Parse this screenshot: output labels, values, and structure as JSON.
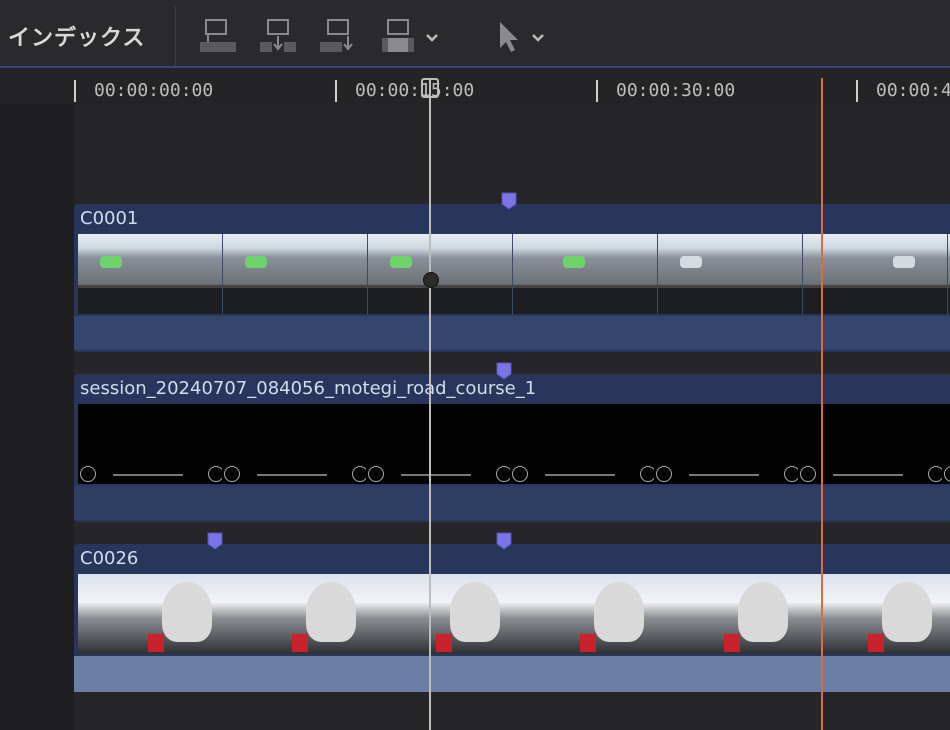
{
  "toolbar": {
    "index_label": "インデックス",
    "buttons": [
      {
        "icon": "connect-clip-icon"
      },
      {
        "icon": "insert-clip-icon"
      },
      {
        "icon": "append-clip-icon"
      },
      {
        "icon": "overwrite-clip-icon"
      },
      {
        "icon": "select-tool-icon"
      }
    ]
  },
  "ruler": {
    "timecodes": [
      "00:00:00:00",
      "00:00:15:00",
      "00:00:30:00",
      "00:00:4"
    ]
  },
  "clips": [
    {
      "name": "C0001"
    },
    {
      "name": "session_20240707_084056_motegi_road_course_1"
    },
    {
      "name": "C0026"
    }
  ],
  "colors": {
    "clip_bg": "#27365a",
    "audio_bg": "#35466e",
    "marker": "#7b74e4",
    "skimmer": "#e06a3d",
    "toolbar_accent": "#3c3f8a"
  }
}
